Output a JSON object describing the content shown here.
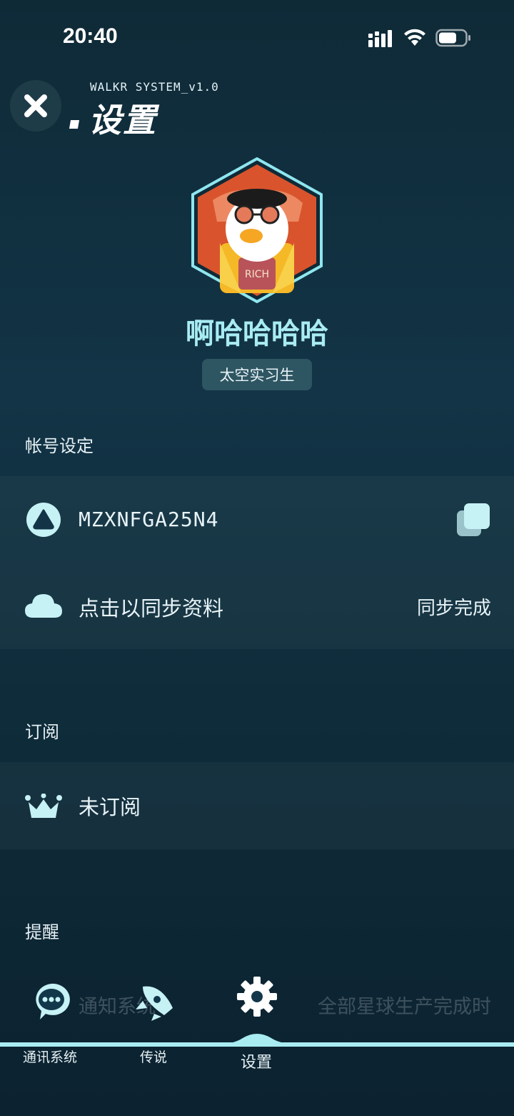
{
  "status_bar": {
    "time": "20:40"
  },
  "header": {
    "system_label": "WALKR SYSTEM_v1.0",
    "title": "设置"
  },
  "profile": {
    "username": "啊哈哈哈哈",
    "rank": "太空实习生",
    "avatar_text": "RICH"
  },
  "account_section": {
    "label": "帐号设定",
    "account_id": "MZXNFGA25N4",
    "sync_label": "点击以同步资料",
    "sync_status": "同步完成"
  },
  "subscription_section": {
    "label": "订阅",
    "status": "未订阅"
  },
  "reminder_section": {
    "label": "提醒",
    "notification_label": "通知系统",
    "notification_value": "全部星球生产完成时"
  },
  "tabbar": {
    "items": [
      {
        "label": "通讯系统",
        "icon": "chat-bubble-icon"
      },
      {
        "label": "传说",
        "icon": "rocket-icon"
      },
      {
        "label": "设置",
        "icon": "gear-icon",
        "active": true
      }
    ]
  },
  "colors": {
    "accent": "#a8ecf2",
    "background": "#123446",
    "badge": "#2e5562"
  }
}
